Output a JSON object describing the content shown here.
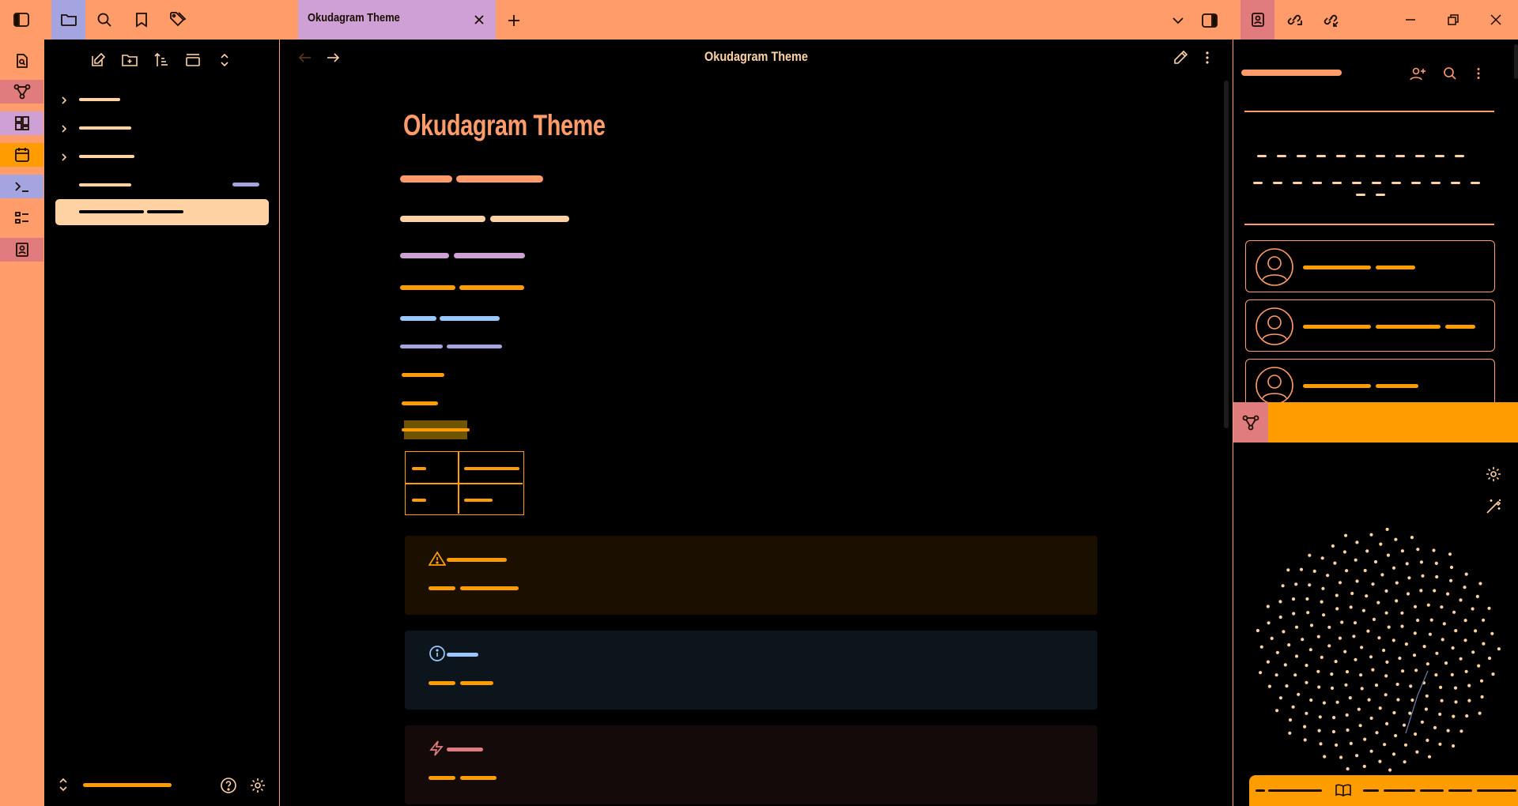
{
  "window": {
    "tab_title": "Okudagram Theme"
  },
  "note": {
    "header_title": "Okudagram Theme",
    "title": "Okudagram Theme"
  },
  "colors": {
    "ribbon": "#ff9c69",
    "accent_orange": "#ff9c00",
    "peach": "#ffd2a4",
    "lilac": "#cfa0d6",
    "periwinkle": "#a3a4e0",
    "sky": "#9bc7ff",
    "rose": "#e07c7e",
    "warning_bg": "#1b1000",
    "info_bg": "#0c151c",
    "danger_bg": "#150a0a"
  },
  "icons": {
    "topbar": [
      "sidebar-toggle-icon",
      "folder-icon",
      "search-icon",
      "bookmark-icon",
      "tag-icon",
      "plus-icon",
      "close-icon",
      "chevron-down-icon",
      "right-sidebar-icon",
      "contact-card-icon",
      "link-out-icon",
      "link-in-icon",
      "minimize-icon",
      "restore-icon",
      "close-window-icon"
    ],
    "ribbon": [
      "file-search-icon",
      "graph-icon",
      "canvas-icon",
      "calendar-icon",
      "terminal-icon",
      "list-icon",
      "contact-card-icon"
    ],
    "left_toolbar": [
      "new-note-icon",
      "new-folder-icon",
      "sort-icon",
      "collapse-icon",
      "expand-icon"
    ],
    "editor": [
      "back-icon",
      "forward-icon",
      "edit-icon",
      "more-icon"
    ],
    "callouts": [
      "warning-icon",
      "info-icon",
      "bolt-icon"
    ],
    "right": [
      "add-contact-icon",
      "search-icon",
      "more-icon",
      "avatar-icon",
      "graph-icon",
      "gear-icon",
      "magic-wand-icon",
      "book-icon"
    ]
  }
}
